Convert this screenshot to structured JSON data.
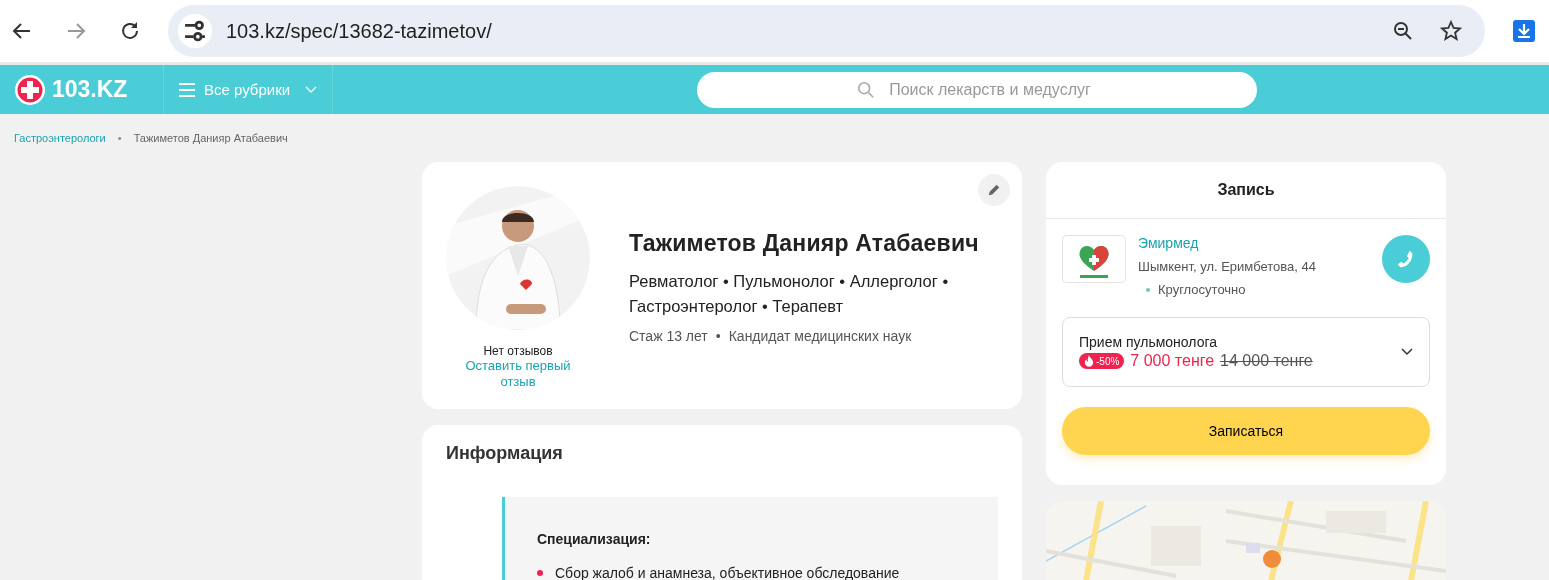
{
  "browser": {
    "url": "103.kz/spec/13682-tazimetov/"
  },
  "header": {
    "logo": "103.KZ",
    "menu": "Все рубрики",
    "search_placeholder": "Поиск лекарств и медуслуг"
  },
  "breadcrumbs": [
    {
      "label": "Гастроэнтерологи",
      "kind": "link"
    },
    {
      "label": "•",
      "kind": "separator"
    },
    {
      "label": "Тажиметов Данияр Атабаевич",
      "kind": "current"
    }
  ],
  "doctor": {
    "name": "Тажиметов Данияр Атабаевич",
    "specialties": "Ревматолог • Пульмонолог • Аллерголог • Гастроэнтеролог • Терапевт",
    "experience": "Стаж 13 лет",
    "meta_separator": "•",
    "degree": "Кандидат медицинских наук",
    "reviews": "Нет отзывов",
    "review_link": "Оставить первый отзыв"
  },
  "info": {
    "title": "Информация",
    "section_title": "Специализация:",
    "items": [
      "Сбор жалоб и анамнеза, объективное обследование"
    ]
  },
  "booking": {
    "title": "Запись",
    "clinic": {
      "name": "Эмирмед",
      "address": "Шымкент, ул. Еримбетова, 44",
      "hours": "Круглосуточно"
    },
    "service": {
      "name": "Прием пульмонолога",
      "discount": "-50%",
      "price": "7 000 тенге",
      "old_price": "14 000 тенге"
    },
    "button": "Записаться"
  }
}
